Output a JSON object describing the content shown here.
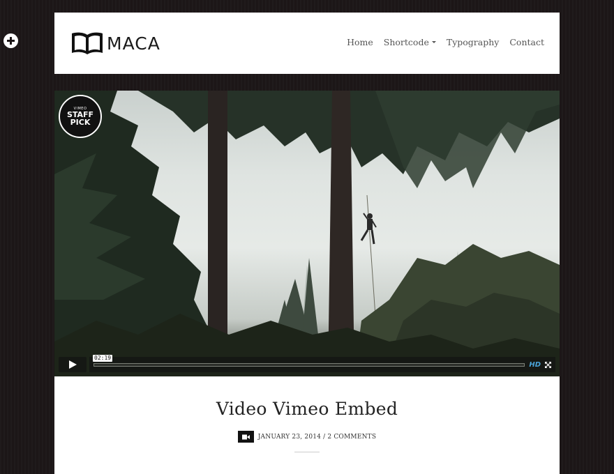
{
  "site": {
    "logo_text": "MACA"
  },
  "nav": {
    "items": [
      {
        "label": "Home"
      },
      {
        "label": "Shortcode"
      },
      {
        "label": "Typography"
      },
      {
        "label": "Contact"
      }
    ]
  },
  "video": {
    "badge_top": "VIMEO",
    "badge_line1": "STAFF",
    "badge_line2": "PICK",
    "timestamp": "02:19",
    "hd_label": "HD",
    "progress": 0.0
  },
  "post": {
    "title": "Video Vimeo Embed",
    "date": "JANUARY 23, 2014",
    "separator": "/",
    "comments": "2 COMMENTS"
  },
  "icons": {
    "toggle": "plus-circle-icon",
    "logo": "book-icon",
    "format": "video-camera-icon"
  },
  "colors": {
    "background": "#1c1617",
    "panel": "#ffffff",
    "hd_accent": "#4aa3d8"
  }
}
